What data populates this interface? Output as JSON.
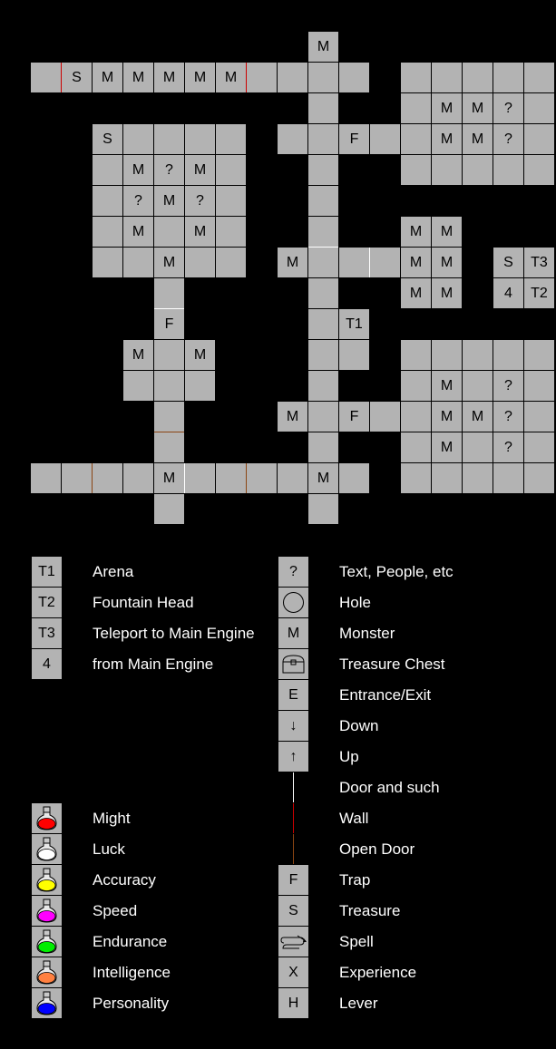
{
  "colors": {
    "background": "#000000",
    "cell": "#b3b3b3",
    "wall": "#cc0000",
    "door": "#ffffff",
    "open_door": "#8b4513",
    "potion_might": "#ff0000",
    "potion_luck": "#ffffff",
    "potion_accuracy": "#ffff00",
    "potion_speed": "#ff00ff",
    "potion_endurance": "#00ee00",
    "potion_intelligence": "#ff8040",
    "potion_personality": "#0000ff"
  },
  "map": {
    "rows": [
      {
        "row": 0,
        "cells": [
          {
            "c": 9,
            "t": "M"
          }
        ]
      },
      {
        "row": 1,
        "cells": [
          {
            "c": 0,
            "t": ""
          },
          {
            "c": 1,
            "t": "S"
          },
          {
            "c": 2,
            "t": "M"
          },
          {
            "c": 3,
            "t": "M"
          },
          {
            "c": 4,
            "t": "M"
          },
          {
            "c": 5,
            "t": "M"
          },
          {
            "c": 6,
            "t": "M"
          },
          {
            "c": 7,
            "t": ""
          },
          {
            "c": 8,
            "t": ""
          },
          {
            "c": 9,
            "t": ""
          },
          {
            "c": 10,
            "t": ""
          },
          {
            "c": 12,
            "t": ""
          },
          {
            "c": 13,
            "t": ""
          },
          {
            "c": 14,
            "t": ""
          },
          {
            "c": 15,
            "t": ""
          },
          {
            "c": 16,
            "t": ""
          }
        ]
      },
      {
        "row": 2,
        "cells": [
          {
            "c": 9,
            "t": ""
          },
          {
            "c": 12,
            "t": ""
          },
          {
            "c": 13,
            "t": "M"
          },
          {
            "c": 14,
            "t": "M"
          },
          {
            "c": 15,
            "t": "?"
          },
          {
            "c": 16,
            "t": ""
          }
        ]
      },
      {
        "row": 3,
        "cells": [
          {
            "c": 2,
            "t": "S"
          },
          {
            "c": 3,
            "t": ""
          },
          {
            "c": 4,
            "t": ""
          },
          {
            "c": 5,
            "t": ""
          },
          {
            "c": 6,
            "t": ""
          },
          {
            "c": 8,
            "t": ""
          },
          {
            "c": 9,
            "t": ""
          },
          {
            "c": 10,
            "t": "F"
          },
          {
            "c": 11,
            "t": ""
          },
          {
            "c": 12,
            "t": ""
          },
          {
            "c": 13,
            "t": "M"
          },
          {
            "c": 14,
            "t": "M"
          },
          {
            "c": 15,
            "t": "?"
          },
          {
            "c": 16,
            "t": ""
          }
        ]
      },
      {
        "row": 4,
        "cells": [
          {
            "c": 2,
            "t": ""
          },
          {
            "c": 3,
            "t": "M"
          },
          {
            "c": 4,
            "t": "?"
          },
          {
            "c": 5,
            "t": "M"
          },
          {
            "c": 6,
            "t": ""
          },
          {
            "c": 9,
            "t": ""
          },
          {
            "c": 12,
            "t": ""
          },
          {
            "c": 13,
            "t": ""
          },
          {
            "c": 14,
            "t": ""
          },
          {
            "c": 15,
            "t": ""
          },
          {
            "c": 16,
            "t": ""
          }
        ]
      },
      {
        "row": 5,
        "cells": [
          {
            "c": 2,
            "t": ""
          },
          {
            "c": 3,
            "t": "?"
          },
          {
            "c": 4,
            "t": "M"
          },
          {
            "c": 5,
            "t": "?"
          },
          {
            "c": 6,
            "t": ""
          },
          {
            "c": 9,
            "t": ""
          }
        ]
      },
      {
        "row": 6,
        "cells": [
          {
            "c": 2,
            "t": ""
          },
          {
            "c": 3,
            "t": "M"
          },
          {
            "c": 4,
            "t": ""
          },
          {
            "c": 5,
            "t": "M"
          },
          {
            "c": 6,
            "t": ""
          },
          {
            "c": 9,
            "t": ""
          },
          {
            "c": 12,
            "t": "M"
          },
          {
            "c": 13,
            "t": "M"
          }
        ]
      },
      {
        "row": 7,
        "cells": [
          {
            "c": 2,
            "t": ""
          },
          {
            "c": 3,
            "t": ""
          },
          {
            "c": 4,
            "t": "M"
          },
          {
            "c": 5,
            "t": ""
          },
          {
            "c": 6,
            "t": ""
          },
          {
            "c": 8,
            "t": "M"
          },
          {
            "c": 9,
            "t": ""
          },
          {
            "c": 10,
            "t": ""
          },
          {
            "c": 11,
            "t": ""
          },
          {
            "c": 12,
            "t": "M"
          },
          {
            "c": 13,
            "t": "M"
          },
          {
            "c": 15,
            "t": "S"
          },
          {
            "c": 16,
            "t": "T3"
          }
        ]
      },
      {
        "row": 8,
        "cells": [
          {
            "c": 4,
            "t": ""
          },
          {
            "c": 9,
            "t": ""
          },
          {
            "c": 12,
            "t": "M"
          },
          {
            "c": 13,
            "t": "M"
          },
          {
            "c": 15,
            "t": "4"
          },
          {
            "c": 16,
            "t": "T2"
          }
        ]
      },
      {
        "row": 9,
        "cells": [
          {
            "c": 4,
            "t": "F"
          },
          {
            "c": 9,
            "t": ""
          },
          {
            "c": 10,
            "t": "T1"
          }
        ]
      },
      {
        "row": 10,
        "cells": [
          {
            "c": 3,
            "t": "M"
          },
          {
            "c": 4,
            "t": ""
          },
          {
            "c": 5,
            "t": "M"
          },
          {
            "c": 9,
            "t": ""
          },
          {
            "c": 10,
            "t": ""
          },
          {
            "c": 12,
            "t": ""
          },
          {
            "c": 13,
            "t": ""
          },
          {
            "c": 14,
            "t": ""
          },
          {
            "c": 15,
            "t": ""
          },
          {
            "c": 16,
            "t": ""
          }
        ]
      },
      {
        "row": 11,
        "cells": [
          {
            "c": 3,
            "t": ""
          },
          {
            "c": 4,
            "t": ""
          },
          {
            "c": 5,
            "t": ""
          },
          {
            "c": 9,
            "t": ""
          },
          {
            "c": 12,
            "t": ""
          },
          {
            "c": 13,
            "t": "M"
          },
          {
            "c": 14,
            "t": ""
          },
          {
            "c": 15,
            "t": "?"
          },
          {
            "c": 16,
            "t": ""
          }
        ]
      },
      {
        "row": 12,
        "cells": [
          {
            "c": 4,
            "t": ""
          },
          {
            "c": 8,
            "t": "M"
          },
          {
            "c": 9,
            "t": ""
          },
          {
            "c": 10,
            "t": "F"
          },
          {
            "c": 11,
            "t": ""
          },
          {
            "c": 12,
            "t": ""
          },
          {
            "c": 13,
            "t": "M"
          },
          {
            "c": 14,
            "t": "M"
          },
          {
            "c": 15,
            "t": "?"
          },
          {
            "c": 16,
            "t": ""
          }
        ]
      },
      {
        "row": 13,
        "cells": [
          {
            "c": 4,
            "t": ""
          },
          {
            "c": 9,
            "t": ""
          },
          {
            "c": 12,
            "t": ""
          },
          {
            "c": 13,
            "t": "M"
          },
          {
            "c": 14,
            "t": ""
          },
          {
            "c": 15,
            "t": "?"
          },
          {
            "c": 16,
            "t": ""
          }
        ]
      },
      {
        "row": 14,
        "cells": [
          {
            "c": 0,
            "t": ""
          },
          {
            "c": 1,
            "t": ""
          },
          {
            "c": 2,
            "t": ""
          },
          {
            "c": 3,
            "t": ""
          },
          {
            "c": 4,
            "t": "M"
          },
          {
            "c": 5,
            "t": ""
          },
          {
            "c": 6,
            "t": ""
          },
          {
            "c": 7,
            "t": ""
          },
          {
            "c": 8,
            "t": ""
          },
          {
            "c": 9,
            "t": "M"
          },
          {
            "c": 10,
            "t": ""
          },
          {
            "c": 12,
            "t": ""
          },
          {
            "c": 13,
            "t": ""
          },
          {
            "c": 14,
            "t": ""
          },
          {
            "c": 15,
            "t": ""
          },
          {
            "c": 16,
            "t": ""
          }
        ]
      },
      {
        "row": 15,
        "cells": [
          {
            "c": 4,
            "t": ""
          },
          {
            "c": 9,
            "t": ""
          }
        ]
      }
    ],
    "edges": [
      {
        "type": "wall",
        "dir": "v",
        "row": 1,
        "col": 1
      },
      {
        "type": "wall",
        "dir": "v",
        "row": 1,
        "col": 7
      },
      {
        "type": "door",
        "dir": "h",
        "row": 7,
        "col": 9
      },
      {
        "type": "door",
        "dir": "v",
        "row": 7,
        "col": 11
      },
      {
        "type": "door",
        "dir": "h",
        "row": 9,
        "col": 4
      },
      {
        "type": "open_door",
        "dir": "h",
        "row": 13,
        "col": 4
      },
      {
        "type": "open_door",
        "dir": "v",
        "row": 14,
        "col": 2
      },
      {
        "type": "door",
        "dir": "v",
        "row": 14,
        "col": 5
      },
      {
        "type": "open_door",
        "dir": "v",
        "row": 14,
        "col": 7
      }
    ]
  },
  "legend": {
    "left": [
      {
        "row": 0,
        "symbol": "T1",
        "label": "Arena"
      },
      {
        "row": 1,
        "symbol": "T2",
        "label": "Fountain Head"
      },
      {
        "row": 2,
        "symbol": "T3",
        "label": "Teleport to Main Engine"
      },
      {
        "row": 3,
        "symbol": "4",
        "label": "from Main Engine"
      },
      {
        "row": 8,
        "potion": "potion_might",
        "label": "Might"
      },
      {
        "row": 9,
        "potion": "potion_luck",
        "label": "Luck"
      },
      {
        "row": 10,
        "potion": "potion_accuracy",
        "label": "Accuracy"
      },
      {
        "row": 11,
        "potion": "potion_speed",
        "label": "Speed"
      },
      {
        "row": 12,
        "potion": "potion_endurance",
        "label": "Endurance"
      },
      {
        "row": 13,
        "potion": "potion_intelligence",
        "label": "Intelligence"
      },
      {
        "row": 14,
        "potion": "potion_personality",
        "label": "Personality"
      }
    ],
    "right": [
      {
        "row": 0,
        "symbol": "?",
        "label": "Text, People, etc"
      },
      {
        "row": 1,
        "icon": "hole-icon",
        "label": "Hole"
      },
      {
        "row": 2,
        "symbol": "M",
        "label": "Monster"
      },
      {
        "row": 3,
        "icon": "treasure-chest-icon",
        "label": "Treasure Chest"
      },
      {
        "row": 4,
        "symbol": "E",
        "label": "Entrance/Exit"
      },
      {
        "row": 5,
        "symbol": "↓",
        "label": "Down"
      },
      {
        "row": 6,
        "symbol": "↑",
        "label": "Up"
      },
      {
        "row": 7,
        "line": "door",
        "label": "Door and such"
      },
      {
        "row": 8,
        "line": "wall",
        "label": "Wall"
      },
      {
        "row": 9,
        "line": "open_door",
        "label": "Open Door"
      },
      {
        "row": 10,
        "symbol": "F",
        "label": "Trap"
      },
      {
        "row": 11,
        "symbol": "S",
        "label": "Treasure"
      },
      {
        "row": 12,
        "icon": "spell-scroll-icon",
        "label": "Spell"
      },
      {
        "row": 13,
        "symbol": "X",
        "label": "Experience"
      },
      {
        "row": 14,
        "symbol": "H",
        "label": "Lever"
      }
    ]
  }
}
